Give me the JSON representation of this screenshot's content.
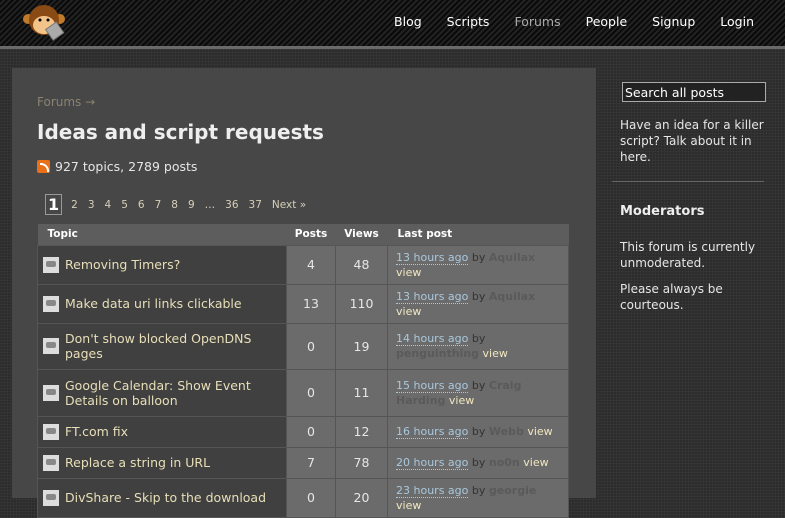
{
  "nav": [
    "Blog",
    "Scripts",
    "Forums",
    "People",
    "Signup",
    "Login"
  ],
  "breadcrumb": "Forums →",
  "title": "Ideas and script requests",
  "stats": "927 topics, 2789 posts",
  "pagination": {
    "current": "1",
    "pages": [
      "2",
      "3",
      "4",
      "5",
      "6",
      "7",
      "8",
      "9",
      "…",
      "36",
      "37"
    ],
    "next": "Next »"
  },
  "table": {
    "headers": [
      "Topic",
      "Posts",
      "Views",
      "Last post"
    ],
    "rows": [
      {
        "topic": "Removing Timers?",
        "posts": "4",
        "views": "48",
        "ago": "13 hours ago",
        "by": "by",
        "user": "Aquilax",
        "view": "view"
      },
      {
        "topic": "Make data uri links clickable",
        "posts": "13",
        "views": "110",
        "ago": "13 hours ago",
        "by": "by",
        "user": "Aquilax",
        "view": "view"
      },
      {
        "topic": "Don't show blocked OpenDNS pages",
        "posts": "0",
        "views": "19",
        "ago": "14 hours ago",
        "by": "by",
        "user": "penguinthing",
        "view": "view"
      },
      {
        "topic": "Google Calendar: Show Event Details on balloon",
        "posts": "0",
        "views": "11",
        "ago": "15 hours ago",
        "by": "by",
        "user": "Craig Harding",
        "view": "view"
      },
      {
        "topic": "FT.com fix",
        "posts": "0",
        "views": "12",
        "ago": "16 hours ago",
        "by": "by",
        "user": "Webb",
        "view": "view"
      },
      {
        "topic": "Replace a string in URL",
        "posts": "7",
        "views": "78",
        "ago": "20 hours ago",
        "by": "by",
        "user": "no0n",
        "view": "view"
      },
      {
        "topic": "DivShare - Skip to the download",
        "posts": "0",
        "views": "20",
        "ago": "23 hours ago",
        "by": "by",
        "user": "georgie",
        "view": "view"
      }
    ]
  },
  "sidebar": {
    "search_value": "Search all posts",
    "intro": "Have an idea for a killer script? Talk about it in here.",
    "moderators_heading": "Moderators",
    "mod_text": "This forum is currently unmoderated.",
    "courtesy": "Please always be courteous."
  }
}
